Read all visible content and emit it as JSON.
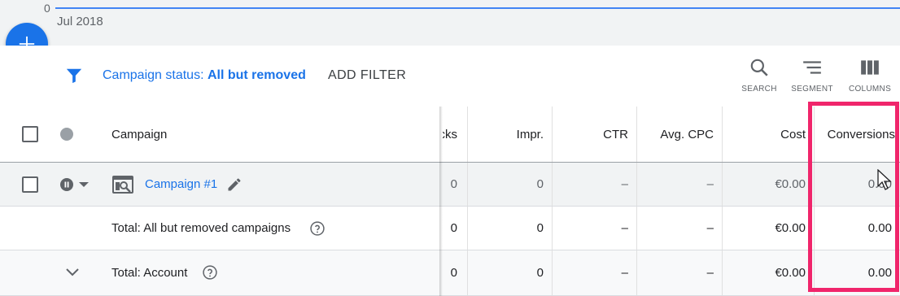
{
  "chart": {
    "zero_label": "0",
    "date_label": "Jul 2018"
  },
  "fab": {
    "icon": "plus-icon"
  },
  "filter": {
    "icon": "filter-icon",
    "prefix": "Campaign status: ",
    "value": "All but removed",
    "add_filter_label": "ADD FILTER"
  },
  "tools": [
    {
      "label": "SEARCH",
      "icon": "search-icon"
    },
    {
      "label": "SEGMENT",
      "icon": "segment-icon"
    },
    {
      "label": "COLUMNS",
      "icon": "columns-icon"
    }
  ],
  "table": {
    "headers": {
      "campaign": "Campaign",
      "clicks": "cks",
      "impr": "Impr.",
      "ctr": "CTR",
      "avg_cpc": "Avg. CPC",
      "cost": "Cost",
      "conversions": "Conversions"
    },
    "rows": [
      {
        "name": "Campaign #1",
        "clicks": "0",
        "impr": "0",
        "ctr": "–",
        "avg_cpc": "–",
        "cost": "€0.00",
        "conversions": "0.00"
      },
      {
        "name": "Total: All but removed campaigns",
        "clicks": "0",
        "impr": "0",
        "ctr": "–",
        "avg_cpc": "–",
        "cost": "€0.00",
        "conversions": "0.00"
      },
      {
        "name": "Total: Account",
        "clicks": "0",
        "impr": "0",
        "ctr": "–",
        "avg_cpc": "–",
        "cost": "€0.00",
        "conversions": "0.00"
      }
    ]
  },
  "colors": {
    "accent": "#1a73e8",
    "highlight": "#f0256b",
    "chart_line": "#4285f4"
  }
}
